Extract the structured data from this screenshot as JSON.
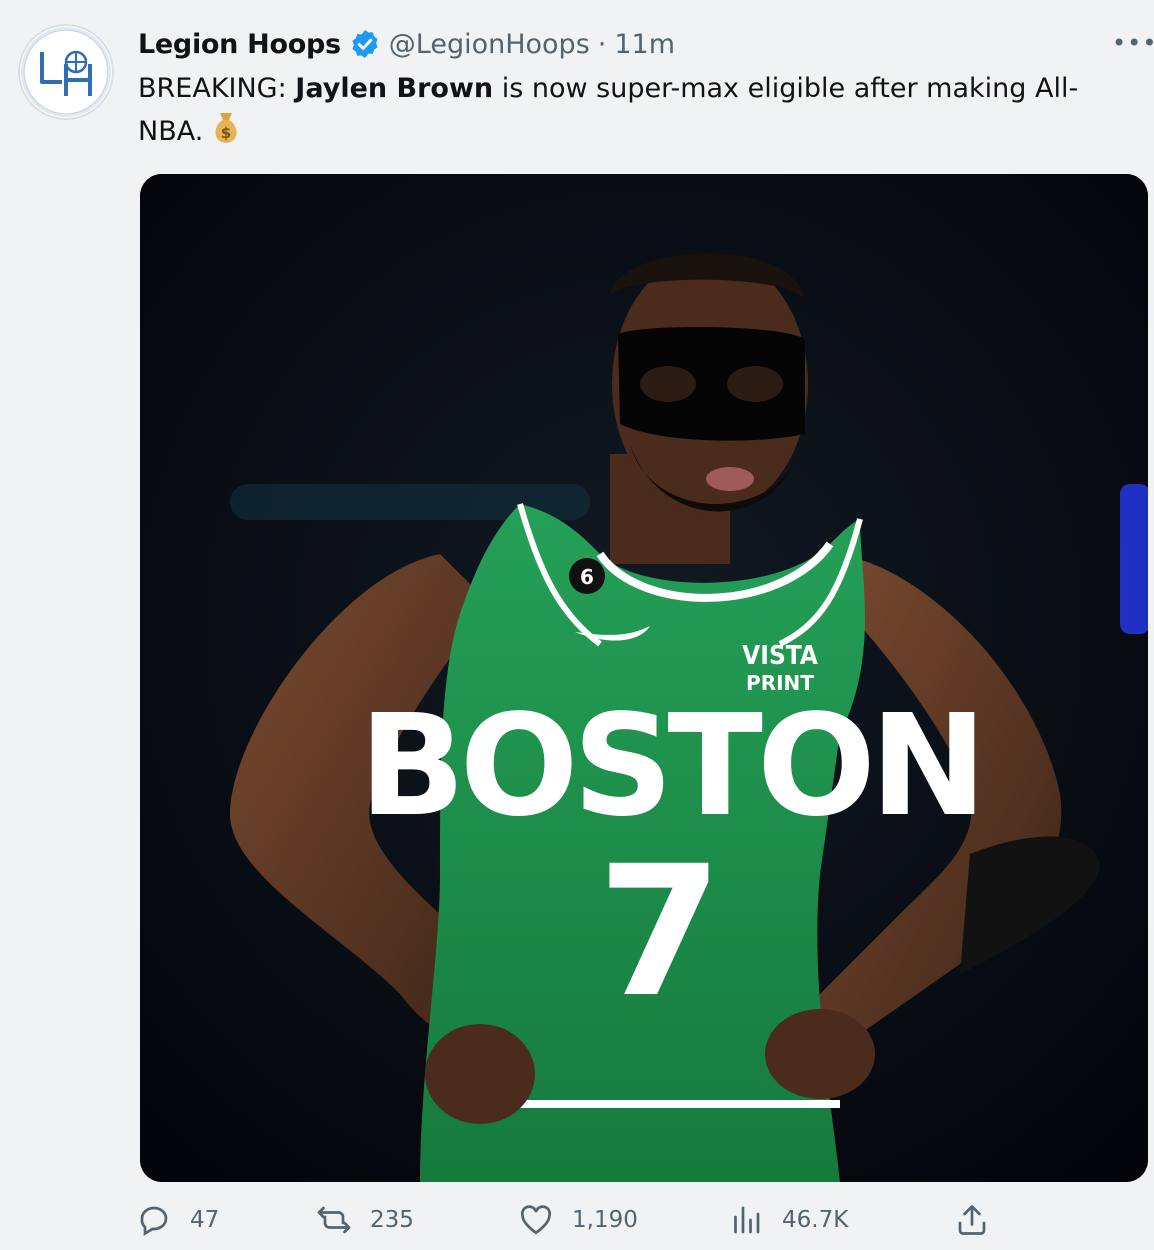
{
  "tweet": {
    "author_name": "Legion Hoops",
    "handle": "@LegionHoops",
    "separator": "·",
    "time": "11m",
    "more_label": "•••",
    "text_prefix": "BREAKING: ",
    "text_bold": "Jaylen Brown",
    "text_suffix": " is now super-max eligible after making All-NBA.",
    "emoji": "money-bag",
    "avatar_letters": "LH",
    "image": {
      "description_icon": "photo",
      "jersey_team": "BOSTON",
      "jersey_number": "7",
      "jersey_badge": "6",
      "sponsor_line1": "VISTA",
      "sponsor_line2": "PRINT"
    }
  },
  "actions": {
    "replies": "47",
    "retweets": "235",
    "likes": "1,190",
    "views": "46.7K"
  },
  "colors": {
    "text": "#0f1419",
    "muted": "#536471",
    "verified": "#1d9bf0",
    "jersey_green": "#1e8a4a",
    "background": "#f1f2f3"
  }
}
